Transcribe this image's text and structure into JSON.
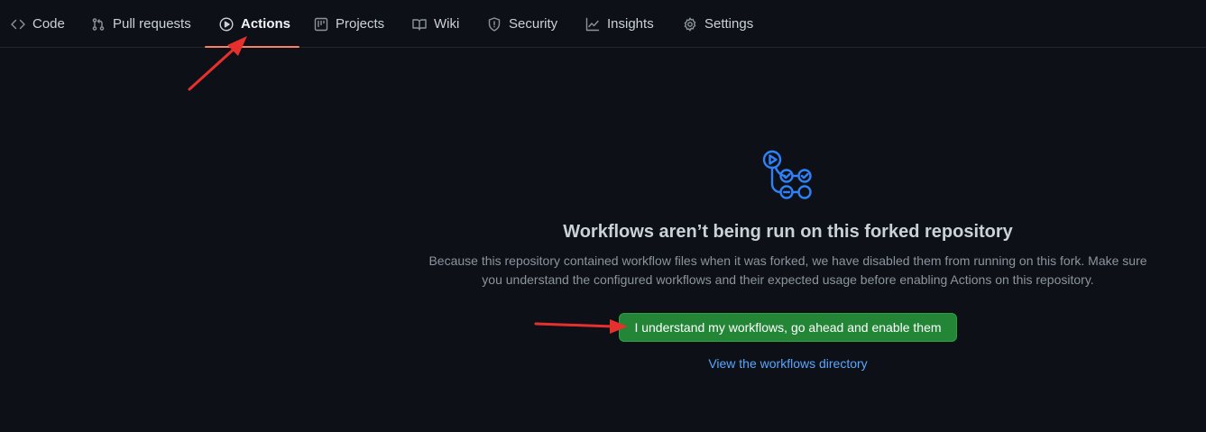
{
  "tabs": [
    {
      "label": "Code",
      "icon": "code-icon"
    },
    {
      "label": "Pull requests",
      "icon": "pull-request-icon"
    },
    {
      "label": "Actions",
      "icon": "play-icon",
      "active": true
    },
    {
      "label": "Projects",
      "icon": "project-icon"
    },
    {
      "label": "Wiki",
      "icon": "book-icon"
    },
    {
      "label": "Security",
      "icon": "shield-icon"
    },
    {
      "label": "Insights",
      "icon": "graph-icon"
    },
    {
      "label": "Settings",
      "icon": "gear-icon"
    }
  ],
  "main": {
    "icon": "workflow-icon",
    "heading": "Workflows aren’t being run on this forked repository",
    "description": "Because this repository contained workflow files when it was forked, we have disabled them from running on this fork. Make sure you understand the configured workflows and their expected usage before enabling Actions on this repository.",
    "enable_button": "I understand my workflows, go ahead and enable them",
    "directory_link": "View the workflows directory"
  },
  "colors": {
    "background": "#0d1117",
    "active_underline": "#f78166",
    "button_green": "#238636",
    "link_blue": "#58a6ff",
    "annotation_arrow": "#e5302d"
  }
}
